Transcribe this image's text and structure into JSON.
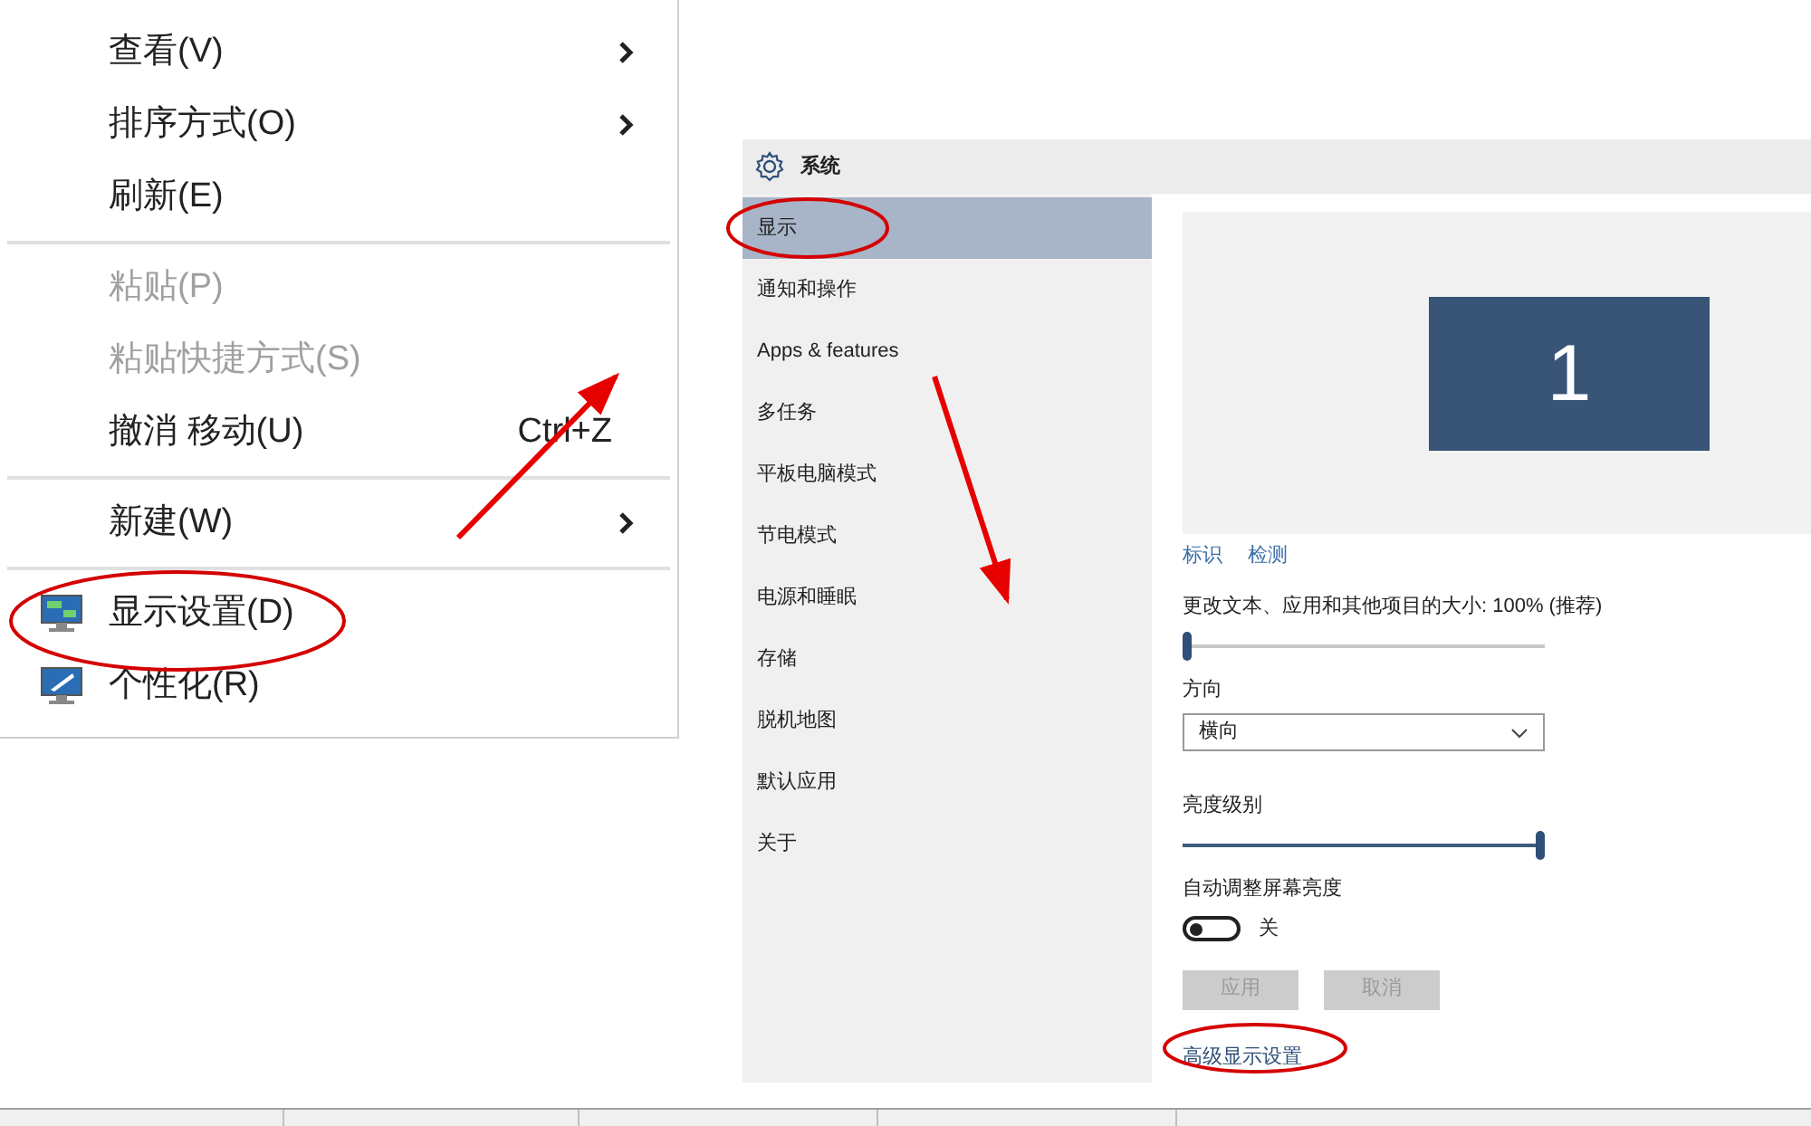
{
  "context_menu": {
    "items": [
      {
        "kind": "item",
        "label": "查看(V)",
        "submenu": true,
        "disabled": false
      },
      {
        "kind": "item",
        "label": "排序方式(O)",
        "submenu": true,
        "disabled": false
      },
      {
        "kind": "item",
        "label": "刷新(E)",
        "submenu": false,
        "disabled": false
      },
      {
        "kind": "separator"
      },
      {
        "kind": "item",
        "label": "粘贴(P)",
        "submenu": false,
        "disabled": true
      },
      {
        "kind": "item",
        "label": "粘贴快捷方式(S)",
        "submenu": false,
        "disabled": true
      },
      {
        "kind": "item",
        "label": "撤消 移动(U)",
        "shortcut": "Ctrl+Z",
        "submenu": false,
        "disabled": false
      },
      {
        "kind": "separator"
      },
      {
        "kind": "item",
        "label": "新建(W)",
        "submenu": true,
        "disabled": false
      },
      {
        "kind": "separator"
      },
      {
        "kind": "display-item",
        "label": "显示设置(D)",
        "submenu": false,
        "disabled": false
      },
      {
        "kind": "personalize-item",
        "label": "个性化(R)",
        "submenu": false,
        "disabled": false
      }
    ]
  },
  "settings": {
    "title": "系统",
    "nav": [
      {
        "label": "显示",
        "selected": true
      },
      {
        "label": "通知和操作",
        "selected": false
      },
      {
        "label": "Apps & features",
        "selected": false
      },
      {
        "label": "多任务",
        "selected": false
      },
      {
        "label": "平板电脑模式",
        "selected": false
      },
      {
        "label": "节电模式",
        "selected": false
      },
      {
        "label": "电源和睡眠",
        "selected": false
      },
      {
        "label": "存储",
        "selected": false
      },
      {
        "label": "脱机地图",
        "selected": false
      },
      {
        "label": "默认应用",
        "selected": false
      },
      {
        "label": "关于",
        "selected": false
      }
    ],
    "display": {
      "monitor_number": "1",
      "links": [
        "标识",
        "检测"
      ],
      "scale": {
        "label": "更改文本、应用和其他项目的大小: 100% (推荐)",
        "level": 0
      },
      "orientation": {
        "label": "方向",
        "value": "横向"
      },
      "brightness": {
        "label": "亮度级别",
        "level": 1
      },
      "auto_brightness": {
        "label": "自动调整屏幕亮度",
        "on": false,
        "state_text": "关"
      },
      "buttons": [
        {
          "label": "应用",
          "disabled": true
        },
        {
          "label": "取消",
          "disabled": true
        }
      ],
      "advanced_link": "高级显示设置"
    }
  }
}
